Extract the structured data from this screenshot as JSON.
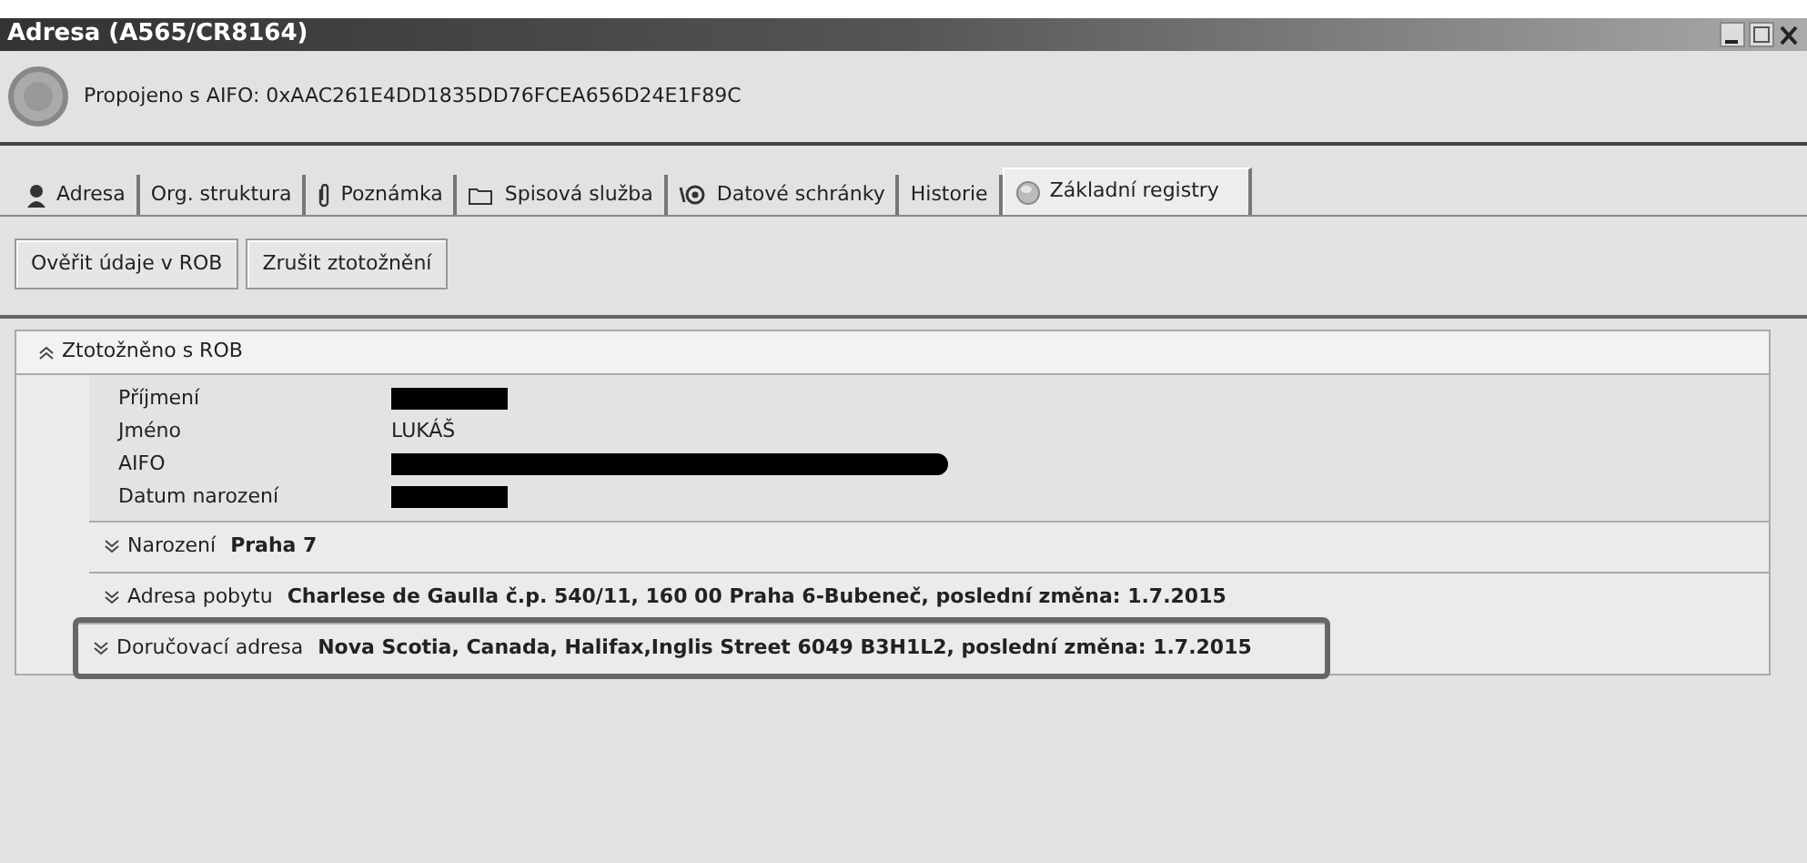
{
  "window": {
    "title": "Adresa (A565/CR8164)"
  },
  "header": {
    "text": "Propojeno s AIFO: 0xAAC261E4DD1835DD76FCEA656D24E1F89C"
  },
  "tabs": [
    {
      "label": "Adresa",
      "selected": false
    },
    {
      "label": "Org. struktura",
      "selected": false
    },
    {
      "label": "Poznámka",
      "selected": false
    },
    {
      "label": "Spisová služba",
      "selected": false
    },
    {
      "label": "Datové schránky",
      "selected": false
    },
    {
      "label": "Historie",
      "selected": false
    },
    {
      "label": "Základní registry",
      "selected": true
    }
  ],
  "buttons": [
    "Ověřit údaje v ROB",
    "Zrušit ztotožnění"
  ],
  "section": {
    "title": "Ztotožněno s ROB",
    "expanded": true,
    "fields": [
      {
        "label": "Příjmení",
        "redacted": true
      },
      {
        "label": "Jméno",
        "value": "LUKÁŠ",
        "redacted": false
      },
      {
        "label": "AIFO",
        "redacted": true
      },
      {
        "label": "Datum narození",
        "redacted": true
      }
    ],
    "subsections": [
      {
        "label": "Narození",
        "value": "Praha 7",
        "expanded": false,
        "highlighted": false
      },
      {
        "label": "Adresa pobytu",
        "value": "Charlese de Gaulla č.p. 540/11, 160 00  Praha 6-Bubeneč, poslední změna: 1.7.2015",
        "expanded": false,
        "highlighted": false
      },
      {
        "label": "Doručovací adresa",
        "value": "Nova Scotia, Canada, Halifax,Inglis Street 6049 B3H1L2, poslední změna: 1.7.2015",
        "expanded": false,
        "highlighted": true
      }
    ]
  }
}
